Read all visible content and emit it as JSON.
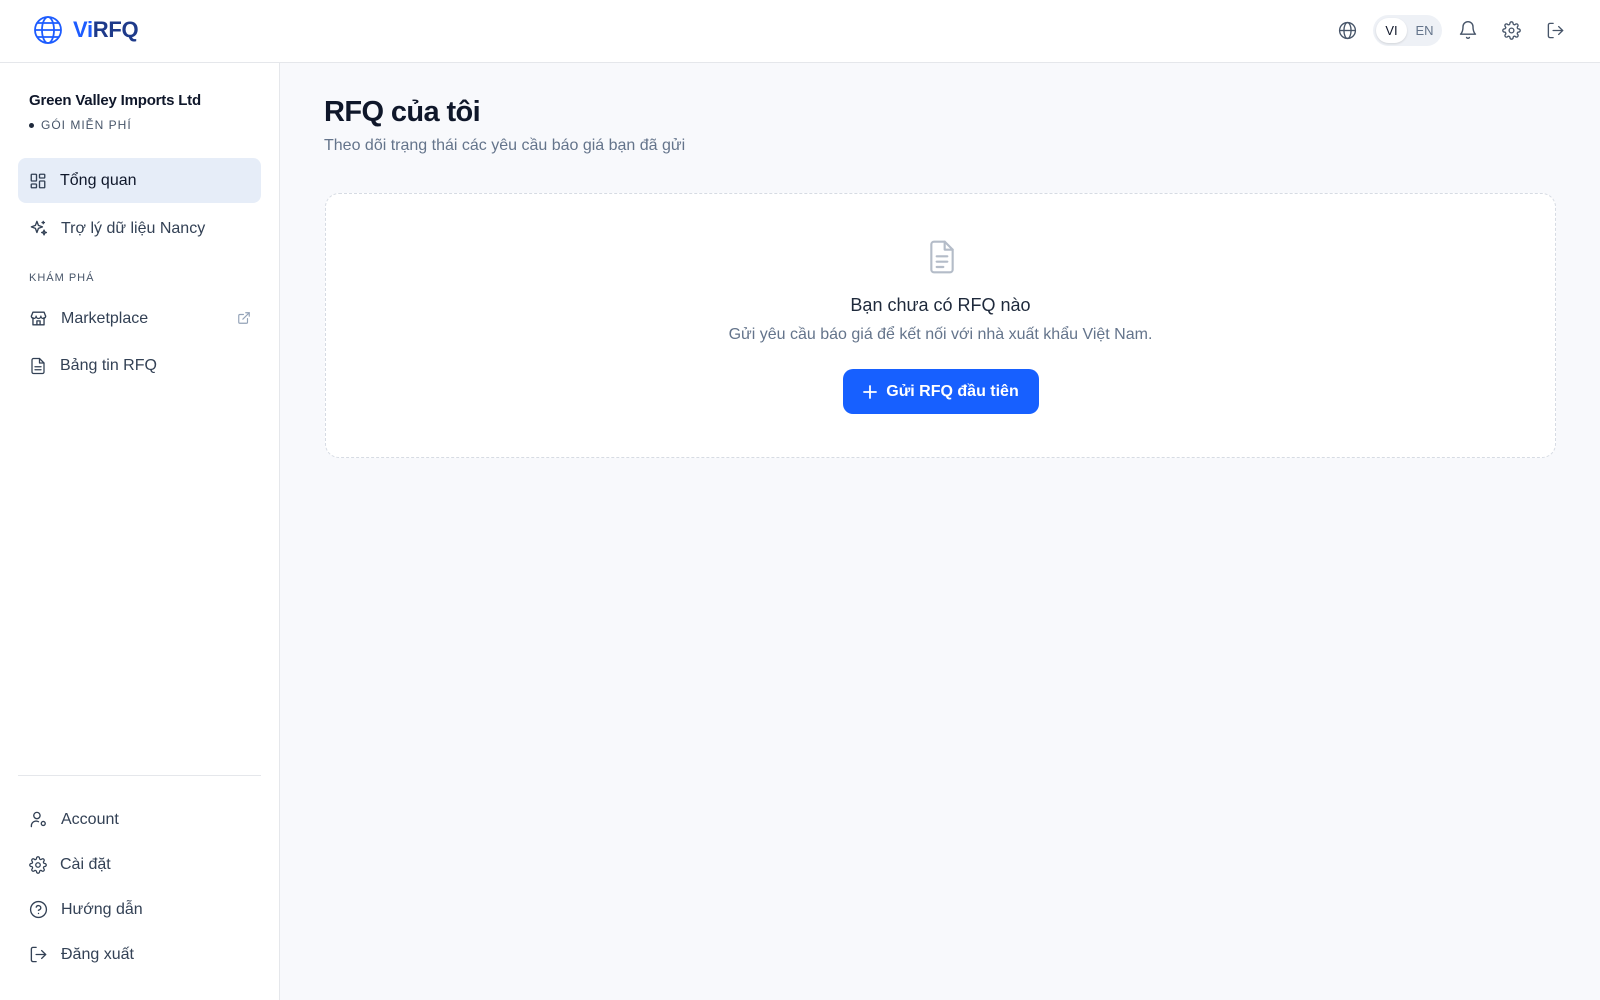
{
  "app": {
    "logo_vi": "Vi",
    "logo_rest": "RFQ"
  },
  "header": {
    "lang_options": [
      "VI",
      "EN"
    ],
    "selected_lang": "VI"
  },
  "sidebar": {
    "org_name": "Green Valley Imports Ltd",
    "plan": "GÓI MIỄN PHÍ",
    "main_items": [
      {
        "label": "Tổng quan",
        "icon": "dashboard-icon",
        "active": true
      },
      {
        "label": "Trợ lý dữ liệu Nancy",
        "icon": "sparkles-icon"
      }
    ],
    "section_label": "KHÁM PHÁ",
    "explore_items": [
      {
        "label": "Marketplace",
        "icon": "store-icon",
        "external": true
      },
      {
        "label": "Bảng tin RFQ",
        "icon": "document-icon"
      }
    ],
    "bottom_items": [
      {
        "label": "Account",
        "icon": "user-settings-icon"
      },
      {
        "label": "Cài đặt",
        "icon": "gear-icon"
      },
      {
        "label": "Hướng dẫn",
        "icon": "help-icon"
      },
      {
        "label": "Đăng xuất",
        "icon": "logout-icon"
      }
    ]
  },
  "main": {
    "title": "RFQ của tôi",
    "subtitle": "Theo dõi trạng thái các yêu cầu báo giá bạn đã gửi",
    "empty": {
      "title": "Bạn chưa có RFQ nào",
      "description": "Gửi yêu cầu báo giá để kết nối với nhà xuất khẩu Việt Nam.",
      "cta_label": "Gửi RFQ đầu tiên"
    }
  },
  "colors": {
    "accent": "#1760ff",
    "active_nav_bg": "#e6edf8",
    "logo_dark": "#1e3a8a"
  }
}
